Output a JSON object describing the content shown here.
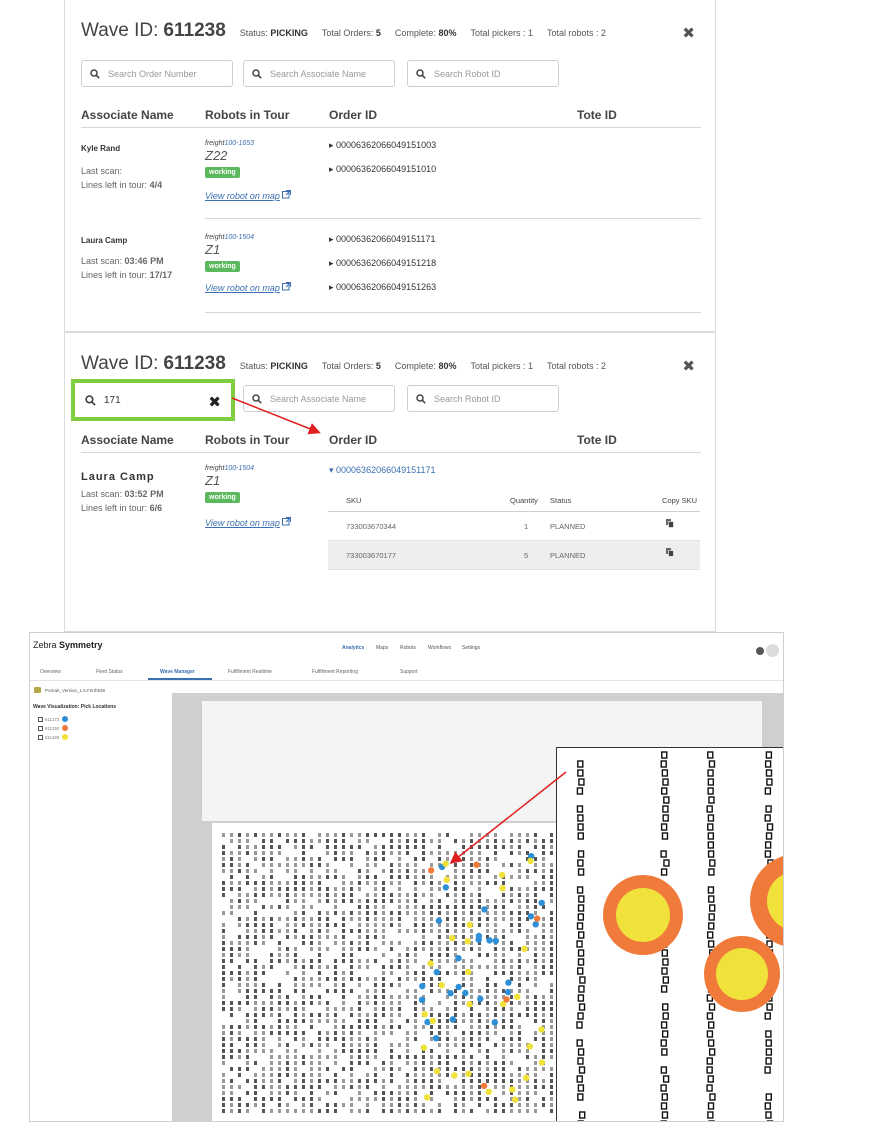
{
  "panel1": {
    "title": "Wave ID:",
    "wave_id": "611238",
    "status_label": "Status:",
    "status_value": "PICKING",
    "total_orders_label": "Total Orders:",
    "total_orders": "5",
    "complete_label": "Complete:",
    "complete": "80%",
    "total_pickers": "Total pickers : 1",
    "total_robots": "Total robots : 2",
    "search_order_placeholder": "Search Order Number",
    "search_associate_placeholder": "Search Associate Name",
    "search_robot_placeholder": "Search Robot ID",
    "columns": [
      "Associate Name",
      "Robots in Tour",
      "Order ID",
      "Tote ID"
    ],
    "rows": [
      {
        "associate": "Kyle Rand",
        "last_scan_label": "Last scan:",
        "last_scan": "",
        "lines_label": "Lines left in tour:",
        "lines": "4/4",
        "robot_prefix": "freight",
        "robot_id": "100-1653",
        "zone": "Z22",
        "robot_status": "working",
        "map_link": "View robot on map",
        "orders": [
          "00006362066049151003",
          "00006362066049151010"
        ]
      },
      {
        "associate": "Laura Camp",
        "last_scan_label": "Last scan:",
        "last_scan": "03:46 PM",
        "lines_label": "Lines left in tour:",
        "lines": "17/17",
        "robot_prefix": "freight",
        "robot_id": "100-1504",
        "zone": "Z1",
        "robot_status": "working",
        "map_link": "View robot on map",
        "orders": [
          "00006362066049151171",
          "00006362066049151218",
          "00006362066049151263"
        ]
      }
    ]
  },
  "panel2": {
    "title": "Wave ID:",
    "wave_id": "611238",
    "status_label": "Status:",
    "status_value": "PICKING",
    "total_orders_label": "Total Orders:",
    "total_orders": "5",
    "complete_label": "Complete:",
    "complete": "80%",
    "total_pickers": "Total pickers : 1",
    "total_robots": "Total robots : 2",
    "search_order_value": "171",
    "search_associate_placeholder": "Search Associate Name",
    "search_robot_placeholder": "Search Robot ID",
    "columns": [
      "Associate Name",
      "Robots in Tour",
      "Order ID",
      "Tote ID"
    ],
    "row": {
      "associate": "Laura Camp",
      "last_scan_label": "Last scan:",
      "last_scan": "03:52 PM",
      "lines_label": "Lines left in tour:",
      "lines": "6/6",
      "robot_prefix": "freight",
      "robot_id": "100-1504",
      "zone": "Z1",
      "robot_status": "working",
      "map_link": "View robot on map",
      "order": "00006362066049151171"
    },
    "sku_columns": [
      "SKU",
      "Quantity",
      "Status",
      "Copy SKU"
    ],
    "sku_rows": [
      {
        "sku": "733003670344",
        "quantity": "1",
        "status": "PLANNED"
      },
      {
        "sku": "733003670177",
        "quantity": "5",
        "status": "PLANNED"
      }
    ]
  },
  "app": {
    "brand_a": "Zebra ",
    "brand_b": "Symmetry",
    "nav": [
      "Analytics",
      "Maps",
      "Robots",
      "Workflows",
      "Settings"
    ],
    "subnav": [
      "Overview",
      "Fleet Status",
      "Wave Manager",
      "Fulfillment Realtime",
      "Fulfillment Reporting",
      "Support"
    ],
    "file_name": "Portrait_Version_1.5.Fnrth538",
    "vis_title": "Wave Visualization: Pick Locations",
    "legend": [
      {
        "label": "611172",
        "color": "#2f8fd6"
      },
      {
        "label": "611192",
        "color": "#f07a3a"
      },
      {
        "label": "611193",
        "color": "#f0e23a"
      }
    ]
  },
  "colors": {
    "accent_blue": "#3a6fb0",
    "working_green": "#5cb85c",
    "highlight_green": "#7fce3f",
    "arrow_red": "#e02020",
    "pick_orange": "#f07a3a",
    "pick_yellow": "#f0e23a"
  }
}
